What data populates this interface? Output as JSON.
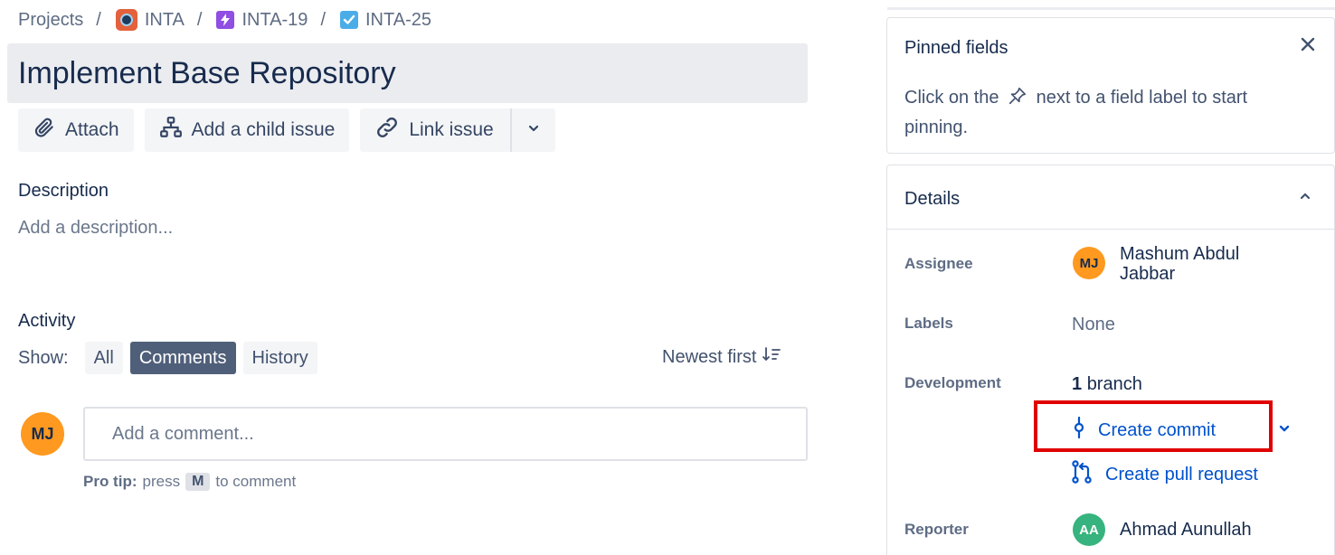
{
  "breadcrumb": {
    "projects": "Projects",
    "project": "INTA",
    "epic": "INTA-19",
    "issue": "INTA-25",
    "separator": "/"
  },
  "issue": {
    "title": "Implement Base Repository"
  },
  "toolbar": {
    "attach": "Attach",
    "add_child": "Add a child issue",
    "link_issue": "Link issue"
  },
  "description": {
    "heading": "Description",
    "placeholder": "Add a description..."
  },
  "activity": {
    "heading": "Activity",
    "show_label": "Show:",
    "filters": [
      "All",
      "Comments",
      "History"
    ],
    "active_filter": "Comments",
    "sort_label": "Newest first"
  },
  "comment": {
    "avatar_initials": "MJ",
    "placeholder": "Add a comment...",
    "protip_bold": "Pro tip:",
    "protip_press": "press",
    "protip_key": "M",
    "protip_rest": "to comment"
  },
  "pinned": {
    "title": "Pinned fields",
    "text_before": "Click on the",
    "text_after": "next to a field label to start pinning."
  },
  "details": {
    "title": "Details",
    "assignee_label": "Assignee",
    "assignee_initials": "MJ",
    "assignee_name": "Mashum Abdul Jabbar",
    "labels_label": "Labels",
    "labels_value": "None",
    "development_label": "Development",
    "branch_count": "1",
    "branch_word": "branch",
    "create_commit": "Create commit",
    "create_pr": "Create pull request",
    "reporter_label": "Reporter",
    "reporter_initials": "AA",
    "reporter_name": "Ahmad Aunullah"
  },
  "colors": {
    "accent": "#0052cc",
    "highlight": "#e00000",
    "active_chip": "#505f79",
    "assignee_avatar": "#ff991f",
    "reporter_avatar": "#36b37e"
  }
}
